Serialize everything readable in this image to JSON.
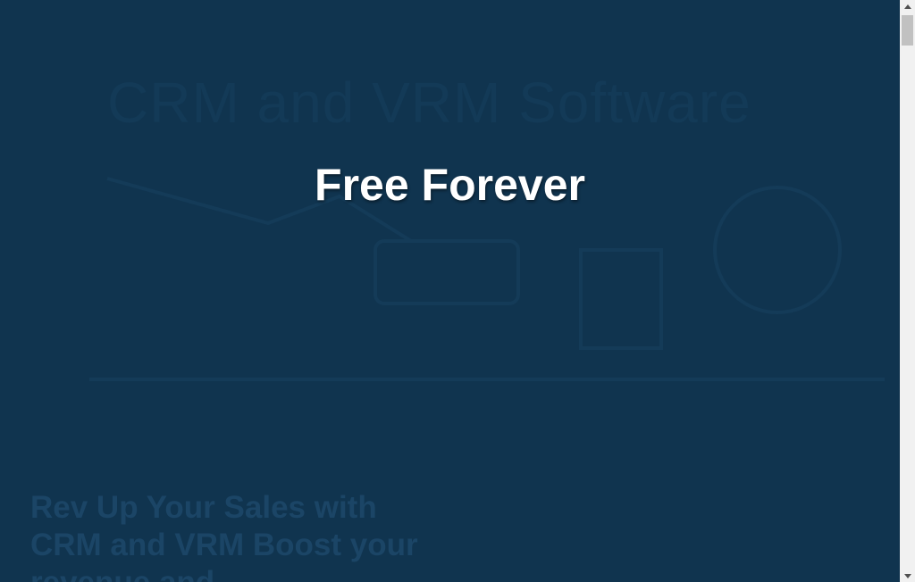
{
  "page": {
    "background_color": "#10344f",
    "logo_text": "",
    "hero_heading": "CRM and VRM Software",
    "overlay_title": "Free Forever",
    "subheading": "Rev Up Your Sales with CRM and VRM Boost your revenue and"
  },
  "scrollbar": {
    "up_icon": "scroll-up-arrow",
    "down_icon": "scroll-down-arrow",
    "scroll_fraction": 0.0
  }
}
